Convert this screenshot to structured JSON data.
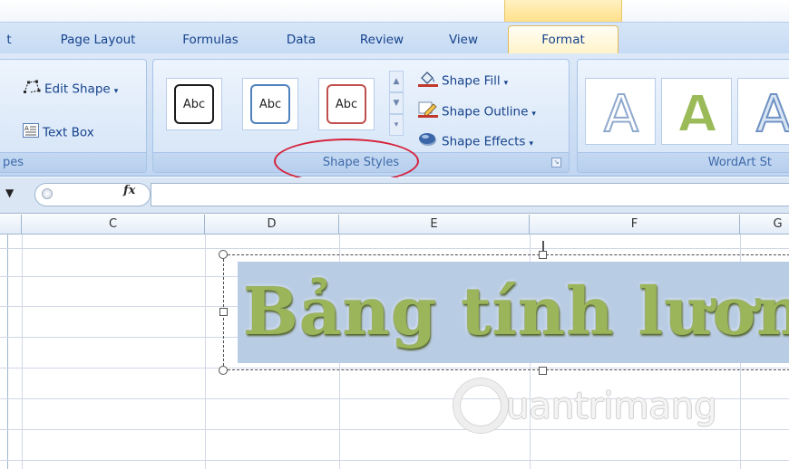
{
  "tabs": [
    {
      "label": "t"
    },
    {
      "label": "Page Layout"
    },
    {
      "label": "Formulas"
    },
    {
      "label": "Data"
    },
    {
      "label": "Review"
    },
    {
      "label": "View"
    },
    {
      "label": "Format",
      "active": true
    }
  ],
  "ribbon": {
    "insert_shapes": {
      "edit_shape_label": "Edit Shape",
      "text_box_label": "Text Box",
      "group_label": "pes"
    },
    "shape_styles": {
      "presets": [
        {
          "label": "Abc",
          "border_color": "#1a1a1a"
        },
        {
          "label": "Abc",
          "border_color": "#4f81bd"
        },
        {
          "label": "Abc",
          "border_color": "#c0504d"
        }
      ],
      "shape_fill_label": "Shape Fill",
      "shape_outline_label": "Shape Outline",
      "shape_effects_label": "Shape Effects",
      "group_label": "Shape Styles"
    },
    "wordart_styles": {
      "letters": [
        "A",
        "A",
        "A"
      ],
      "group_label": "WordArt St"
    }
  },
  "formula_bar": {
    "fx_label": "fx"
  },
  "columns": [
    "C",
    "D",
    "E",
    "F",
    "G"
  ],
  "shape": {
    "text": "Bảng tính lươn"
  },
  "watermark": {
    "text": "uantrimang"
  },
  "colors": {
    "accent_highlight": "#d6213a",
    "wordart_green": "#9bb55a",
    "shape_fill": "#b8cce4"
  }
}
